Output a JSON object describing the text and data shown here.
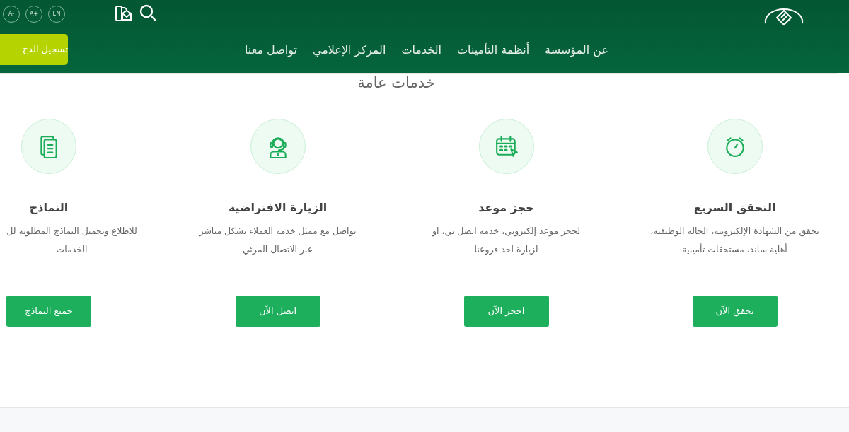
{
  "top_bar": {
    "font_buttons": [
      "EN",
      "A+",
      "A-"
    ]
  },
  "nav": {
    "login_button": "تسجيل الدخ",
    "links": [
      "عن المؤسسة",
      "أنظمة التأمينات",
      "الخدمات",
      "المركز الإعلامي",
      "تواصل معنا"
    ]
  },
  "section": {
    "title": "خدمات عامة"
  },
  "services": [
    {
      "kind": "stopwatch",
      "title": "التحقق السريع",
      "description_lines": [
        "تحقق من الشهادة الإلكترونية، الحالة الوظيفية،",
        "أهلية ساند، مستحقات تأمينية"
      ],
      "button": "تحقق الآن"
    },
    {
      "kind": "calendar",
      "title": "حجز موعد",
      "description_lines": [
        "لحجز موعد إلكتروني، خدمة اتصل بي، او",
        "لزيارة احد فروعنا"
      ],
      "button": "احجز الآن"
    },
    {
      "kind": "support",
      "title": "الزيارة الافتراضية",
      "description_lines": [
        "تواصل مع ممثل خدمة العملاء بشكل مباشر",
        "عبر الاتصال المرئي"
      ],
      "button": "اتصل الآن"
    },
    {
      "kind": "documents",
      "title": "النماذج",
      "description_lines": [
        "للاطلاع وتحميل النماذج المطلوبة لل",
        "الخدمات"
      ],
      "button": "جميع النماذج"
    }
  ]
}
